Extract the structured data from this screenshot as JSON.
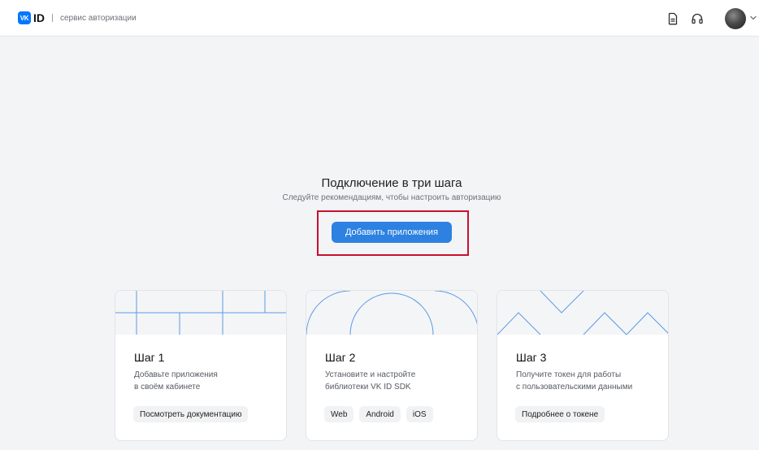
{
  "header": {
    "logo_mark": "VK",
    "logo_text": "ID",
    "subtitle": "сервис авторизации",
    "icons": [
      "document-icon",
      "headset-icon",
      "avatar",
      "chevron-down-icon"
    ]
  },
  "main": {
    "title": "Подключение в три шага",
    "subtitle": "Следуйте рекомендациям, чтобы настроить авторизацию",
    "add_button": "Добавить приложения"
  },
  "cards": [
    {
      "step": "Шаг 1",
      "desc_line1": "Добавьте приложения",
      "desc_line2": "в своём кабинете",
      "chips": [
        "Посмотреть документацию"
      ]
    },
    {
      "step": "Шаг 2",
      "desc_line1": "Установите и настройте",
      "desc_line2": "библиотеки VK ID SDK",
      "chips": [
        "Web",
        "Android",
        "iOS"
      ]
    },
    {
      "step": "Шаг 3",
      "desc_line1": "Получите токен для работы",
      "desc_line2": "с пользовательскими данными",
      "chips": [
        "Подробнее о токене"
      ]
    }
  ],
  "colors": {
    "accent": "#2d81e0",
    "brand": "#0077ff",
    "highlight": "#c8102e",
    "card_art_line": "#5b9be3",
    "background": "#f3f4f6"
  }
}
